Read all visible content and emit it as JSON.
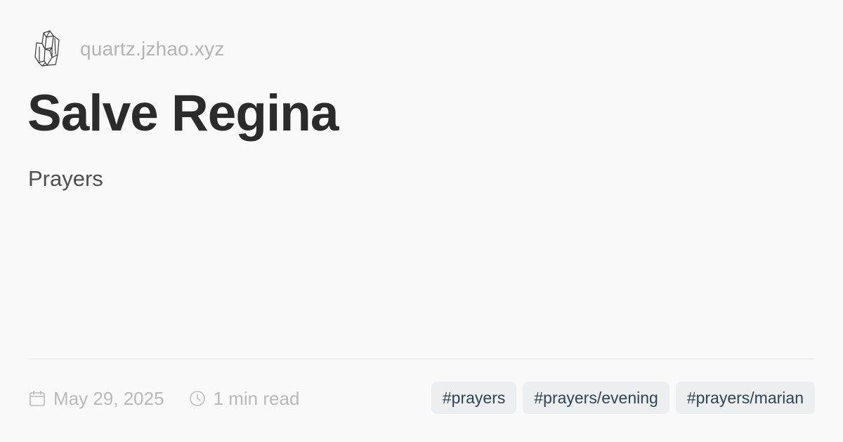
{
  "site": {
    "name": "quartz.jzhao.xyz",
    "logo": "crystal-logo"
  },
  "page": {
    "title": "Salve Regina",
    "subtitle": "Prayers"
  },
  "meta": {
    "date": "May 29, 2025",
    "date_icon": "calendar-icon",
    "reading_time": "1 min read",
    "reading_icon": "clock-icon"
  },
  "tags": [
    "#prayers",
    "#prayers/evening",
    "#prayers/marian"
  ],
  "colors": {
    "background": "#faf9fa",
    "title": "#2b2b2b",
    "subtitle": "#4e4e4e",
    "muted": "#b9b9b9",
    "tag_background": "#eceef0",
    "tag_text": "#2f4554"
  }
}
